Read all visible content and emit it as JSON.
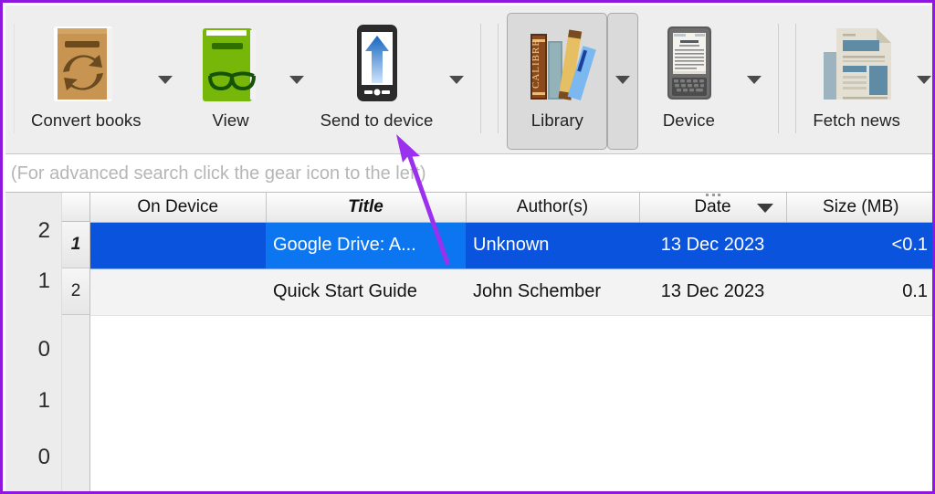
{
  "theme": {
    "annotation_color": "#9b30ee",
    "toolbar_bg": "#eeeeee",
    "selection_blue": "#0a53dd",
    "current_cell_blue": "#0b76f0",
    "border_purple": "#8f17e0"
  },
  "toolbar": {
    "buttons": [
      {
        "label": "Convert books",
        "icon": "convert-books-icon",
        "has_dropdown": true,
        "active": false
      },
      {
        "label": "View",
        "icon": "view-icon",
        "has_dropdown": true,
        "active": false
      },
      {
        "label": "Send to device",
        "icon": "send-to-device-icon",
        "has_dropdown": true,
        "active": false
      },
      {
        "label": "Library",
        "icon": "library-icon",
        "has_dropdown": true,
        "active": true
      },
      {
        "label": "Device",
        "icon": "device-icon",
        "has_dropdown": true,
        "active": false
      },
      {
        "label": "Fetch news",
        "icon": "fetch-news-icon",
        "has_dropdown": true,
        "active": false
      }
    ]
  },
  "search": {
    "value": "",
    "placeholder": "Search (For advanced search click the gear icon to the left)"
  },
  "tag_browser": {
    "counts": [
      "2",
      "1",
      "0",
      "1",
      "0"
    ]
  },
  "book_list": {
    "columns": [
      {
        "key": "on_device",
        "label": "On Device",
        "sorted": false
      },
      {
        "key": "title",
        "label": "Title",
        "sorted": true
      },
      {
        "key": "author",
        "label": "Author(s)",
        "sorted": false
      },
      {
        "key": "date",
        "label": "Date",
        "sorted": false,
        "sort_indicator": "descending"
      },
      {
        "key": "size",
        "label": "Size (MB)",
        "sorted": false
      }
    ],
    "rows": [
      {
        "num": "1",
        "on_device": "",
        "title": "Google Drive: A...",
        "author": "Unknown",
        "date": "13 Dec 2023",
        "size": "<0.1",
        "selected": true,
        "current_cell": "title"
      },
      {
        "num": "2",
        "on_device": "",
        "title": "Quick Start Guide",
        "author": "John Schember",
        "date": "13 Dec 2023",
        "size": "0.1",
        "selected": false,
        "current_cell": ""
      }
    ]
  },
  "annotation": {
    "type": "arrow",
    "points_at": "Send to device",
    "color": "#9b30ee"
  }
}
